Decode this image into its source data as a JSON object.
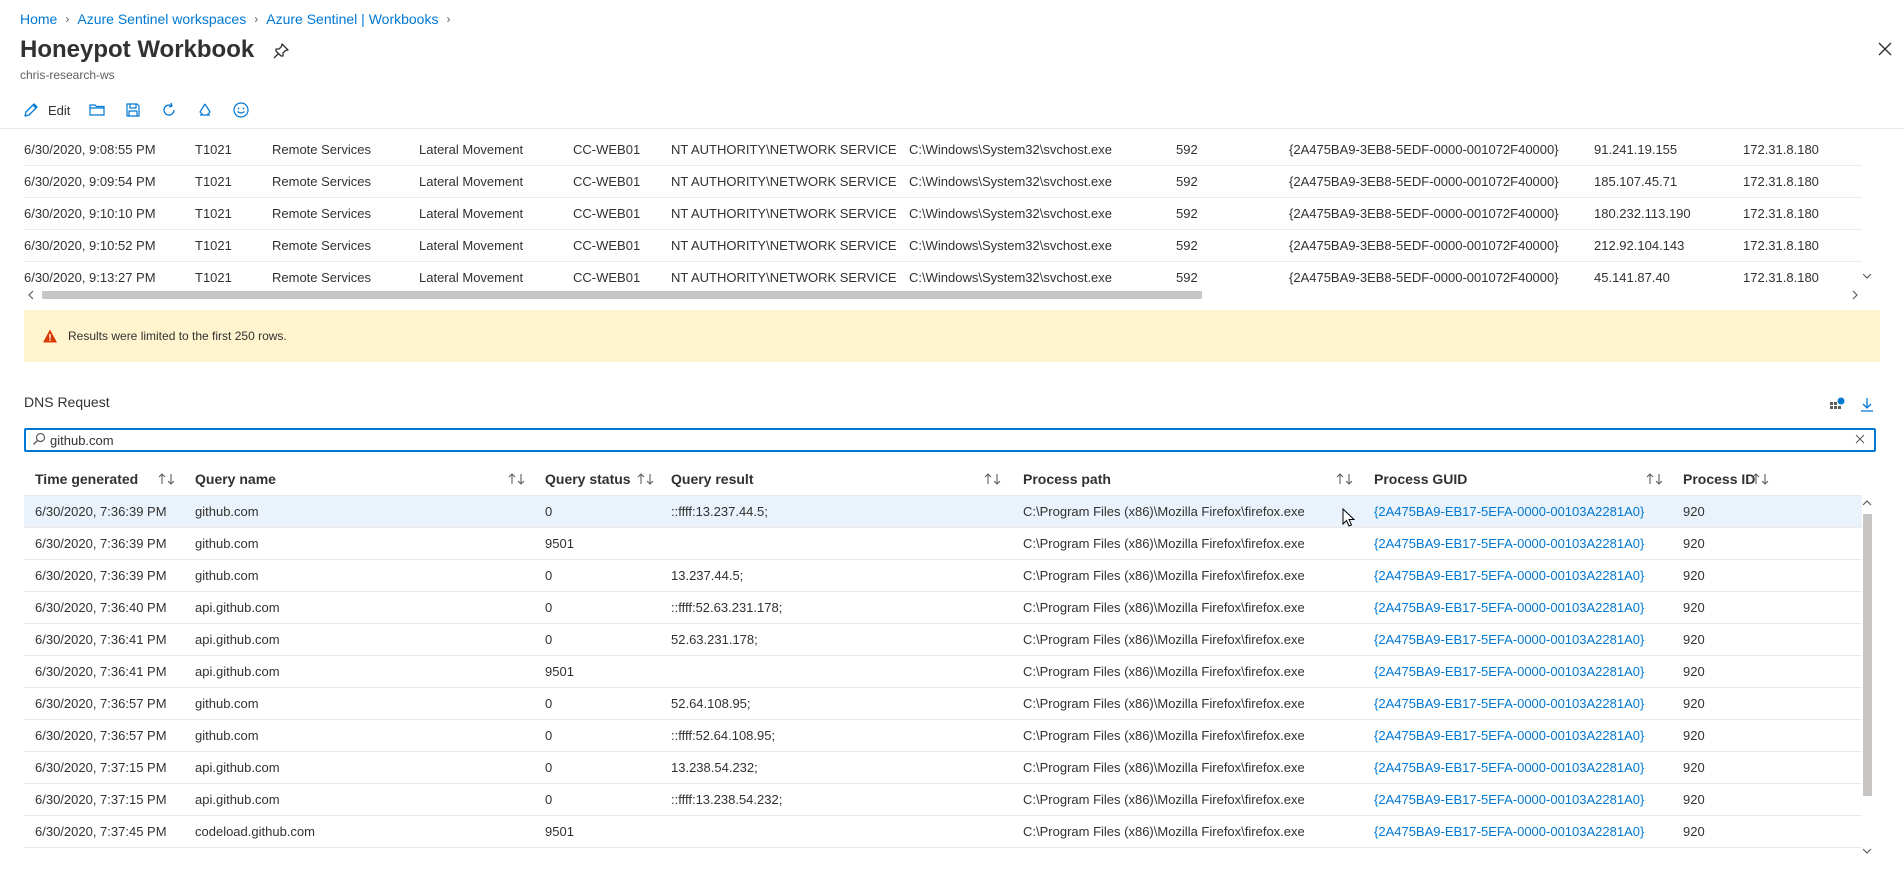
{
  "breadcrumb": {
    "items": [
      "Home",
      "Azure Sentinel workspaces",
      "Azure Sentinel | Workbooks"
    ]
  },
  "page": {
    "title": "Honeypot Workbook",
    "subtitle": "chris-research-ws"
  },
  "toolbar": {
    "edit_label": "Edit"
  },
  "upper_table": {
    "rows": [
      [
        "6/30/2020, 9:08:55 PM",
        "T1021",
        "Remote Services",
        "Lateral Movement",
        "CC-WEB01",
        "NT AUTHORITY\\NETWORK SERVICE",
        "C:\\Windows\\System32\\svchost.exe",
        "592",
        "{2A475BA9-3EB8-5EDF-0000-001072F40000}",
        "91.241.19.155",
        "172.31.8.180"
      ],
      [
        "6/30/2020, 9:09:54 PM",
        "T1021",
        "Remote Services",
        "Lateral Movement",
        "CC-WEB01",
        "NT AUTHORITY\\NETWORK SERVICE",
        "C:\\Windows\\System32\\svchost.exe",
        "592",
        "{2A475BA9-3EB8-5EDF-0000-001072F40000}",
        "185.107.45.71",
        "172.31.8.180"
      ],
      [
        "6/30/2020, 9:10:10 PM",
        "T1021",
        "Remote Services",
        "Lateral Movement",
        "CC-WEB01",
        "NT AUTHORITY\\NETWORK SERVICE",
        "C:\\Windows\\System32\\svchost.exe",
        "592",
        "{2A475BA9-3EB8-5EDF-0000-001072F40000}",
        "180.232.113.190",
        "172.31.8.180"
      ],
      [
        "6/30/2020, 9:10:52 PM",
        "T1021",
        "Remote Services",
        "Lateral Movement",
        "CC-WEB01",
        "NT AUTHORITY\\NETWORK SERVICE",
        "C:\\Windows\\System32\\svchost.exe",
        "592",
        "{2A475BA9-3EB8-5EDF-0000-001072F40000}",
        "212.92.104.143",
        "172.31.8.180"
      ],
      [
        "6/30/2020, 9:13:27 PM",
        "T1021",
        "Remote Services",
        "Lateral Movement",
        "CC-WEB01",
        "NT AUTHORITY\\NETWORK SERVICE",
        "C:\\Windows\\System32\\svchost.exe",
        "592",
        "{2A475BA9-3EB8-5EDF-0000-001072F40000}",
        "45.141.87.40",
        "172.31.8.180"
      ]
    ]
  },
  "warning": {
    "text": "Results were limited to the first 250 rows."
  },
  "dns": {
    "title": "DNS Request",
    "search_value": "github.com",
    "columns": [
      "Time generated",
      "Query name",
      "Query status",
      "Query result",
      "Process path",
      "Process GUID",
      "Process ID"
    ],
    "rows": [
      [
        "6/30/2020, 7:36:39 PM",
        "github.com",
        "0",
        "::ffff:13.237.44.5;",
        "C:\\Program Files (x86)\\Mozilla Firefox\\firefox.exe",
        "{2A475BA9-EB17-5EFA-0000-00103A2281A0}",
        "920"
      ],
      [
        "6/30/2020, 7:36:39 PM",
        "github.com",
        "9501",
        "",
        "C:\\Program Files (x86)\\Mozilla Firefox\\firefox.exe",
        "{2A475BA9-EB17-5EFA-0000-00103A2281A0}",
        "920"
      ],
      [
        "6/30/2020, 7:36:39 PM",
        "github.com",
        "0",
        "13.237.44.5;",
        "C:\\Program Files (x86)\\Mozilla Firefox\\firefox.exe",
        "{2A475BA9-EB17-5EFA-0000-00103A2281A0}",
        "920"
      ],
      [
        "6/30/2020, 7:36:40 PM",
        "api.github.com",
        "0",
        "::ffff:52.63.231.178;",
        "C:\\Program Files (x86)\\Mozilla Firefox\\firefox.exe",
        "{2A475BA9-EB17-5EFA-0000-00103A2281A0}",
        "920"
      ],
      [
        "6/30/2020, 7:36:41 PM",
        "api.github.com",
        "0",
        "52.63.231.178;",
        "C:\\Program Files (x86)\\Mozilla Firefox\\firefox.exe",
        "{2A475BA9-EB17-5EFA-0000-00103A2281A0}",
        "920"
      ],
      [
        "6/30/2020, 7:36:41 PM",
        "api.github.com",
        "9501",
        "",
        "C:\\Program Files (x86)\\Mozilla Firefox\\firefox.exe",
        "{2A475BA9-EB17-5EFA-0000-00103A2281A0}",
        "920"
      ],
      [
        "6/30/2020, 7:36:57 PM",
        "github.com",
        "0",
        "52.64.108.95;",
        "C:\\Program Files (x86)\\Mozilla Firefox\\firefox.exe",
        "{2A475BA9-EB17-5EFA-0000-00103A2281A0}",
        "920"
      ],
      [
        "6/30/2020, 7:36:57 PM",
        "github.com",
        "0",
        "::ffff:52.64.108.95;",
        "C:\\Program Files (x86)\\Mozilla Firefox\\firefox.exe",
        "{2A475BA9-EB17-5EFA-0000-00103A2281A0}",
        "920"
      ],
      [
        "6/30/2020, 7:37:15 PM",
        "api.github.com",
        "0",
        "13.238.54.232;",
        "C:\\Program Files (x86)\\Mozilla Firefox\\firefox.exe",
        "{2A475BA9-EB17-5EFA-0000-00103A2281A0}",
        "920"
      ],
      [
        "6/30/2020, 7:37:15 PM",
        "api.github.com",
        "0",
        "::ffff:13.238.54.232;",
        "C:\\Program Files (x86)\\Mozilla Firefox\\firefox.exe",
        "{2A475BA9-EB17-5EFA-0000-00103A2281A0}",
        "920"
      ],
      [
        "6/30/2020, 7:37:45 PM",
        "codeload.github.com",
        "9501",
        "",
        "C:\\Program Files (x86)\\Mozilla Firefox\\firefox.exe",
        "{2A475BA9-EB17-5EFA-0000-00103A2281A0}",
        "920"
      ]
    ]
  },
  "colors": {
    "accent": "#0078d4",
    "warning_bg": "#fff4ce",
    "warning_icon": "#d83b01",
    "selected_row": "#eaf3fb"
  }
}
